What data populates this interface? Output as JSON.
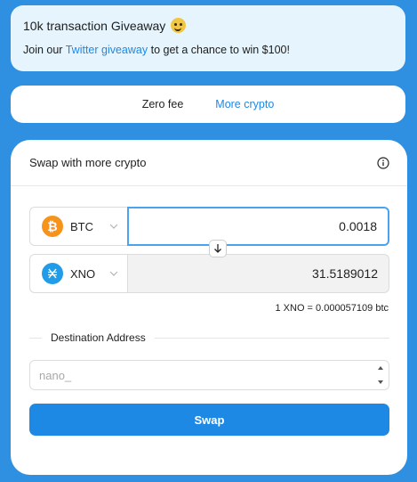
{
  "banner": {
    "title": "10k transaction Giveaway",
    "text_before": "Join our ",
    "link": "Twitter giveaway",
    "text_after": " to get a chance to win $100!"
  },
  "tabs": [
    {
      "label": "Zero fee",
      "active": false
    },
    {
      "label": "More crypto",
      "active": true
    }
  ],
  "card": {
    "title": "Swap with more crypto",
    "from": {
      "coin": "BTC",
      "icon": "bitcoin-icon",
      "amount": "0.0018"
    },
    "to": {
      "coin": "XNO",
      "icon": "nano-icon",
      "amount": "31.5189012"
    },
    "rate": "1 XNO = 0.000057109 btc",
    "destination_label": "Destination Address",
    "address_placeholder": "nano_",
    "swap_label": "Swap"
  },
  "colors": {
    "background": "#2f8fe0",
    "accent": "#1e88e5",
    "bitcoin": "#f7931a",
    "nano": "#209ce9"
  }
}
